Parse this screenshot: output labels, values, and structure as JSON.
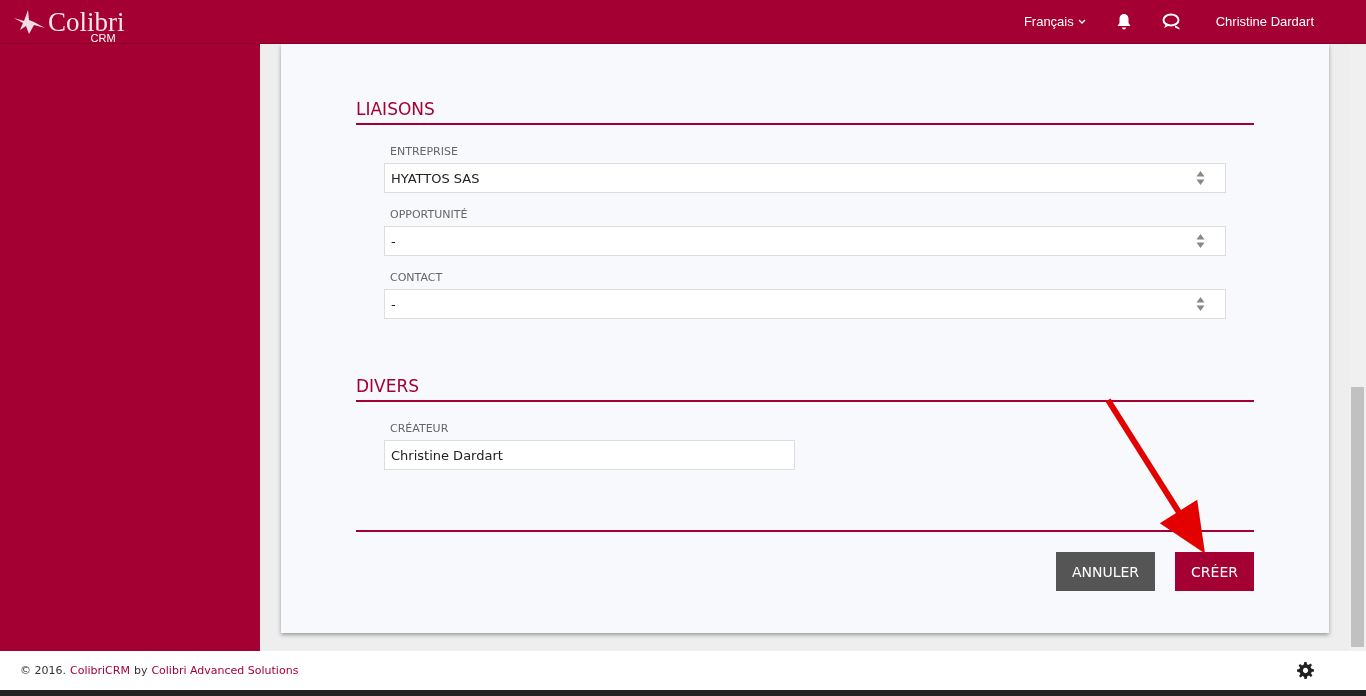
{
  "header": {
    "logo": "Colibri",
    "logo_sub": "CRM",
    "language": "Français",
    "user": "Christine Dardart"
  },
  "sections": [
    {
      "title": "LIAISONS",
      "fields": [
        {
          "kind": "select",
          "label": "ENTREPRISE",
          "value": "HYATTOS SAS"
        },
        {
          "kind": "select",
          "label": "OPPORTUNITÉ",
          "value": "-"
        },
        {
          "kind": "select",
          "label": "CONTACT",
          "value": "-"
        }
      ]
    },
    {
      "title": "DIVERS",
      "fields": [
        {
          "kind": "text",
          "label": "CRÉATEUR",
          "value": "Christine Dardart"
        }
      ]
    }
  ],
  "buttons": [
    {
      "label": "ANNULER",
      "kind": "secondary"
    },
    {
      "label": "CRÉER",
      "kind": "primary"
    }
  ],
  "footer": {
    "prefix": "© 2016.",
    "brand": "ColibriCRM",
    "by": "by",
    "company": "Colibri Advanced Solutions"
  }
}
